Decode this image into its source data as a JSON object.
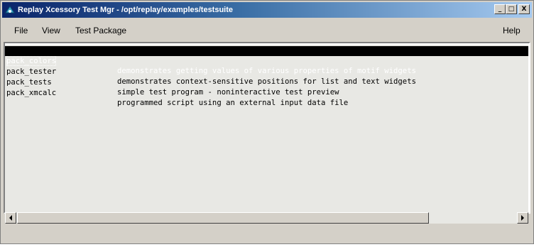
{
  "window": {
    "title": "Replay Xcessory Test Mgr - /opt/replay/examples/testsuite",
    "controls": {
      "minimize": "_",
      "maximize": "□",
      "close": "X"
    }
  },
  "menubar": {
    "items": [
      {
        "label": "File"
      },
      {
        "label": "View"
      },
      {
        "label": "Test Package"
      }
    ],
    "help": "Help"
  },
  "packages": [
    {
      "name": "pack_colors",
      "description": "demonstrates getting values of various properties of motif widgets",
      "selected": true
    },
    {
      "name": "pack_tester",
      "description": "demonstrates context-sensitive positions for list and text widgets",
      "selected": false
    },
    {
      "name": "pack_tests",
      "description": "simple test program - noninteractive test preview",
      "selected": false
    },
    {
      "name": "pack_xmcalc",
      "description": "programmed script using an external input data file",
      "selected": false
    }
  ],
  "scrollbar": {
    "position": 0.0,
    "visible_fraction": 0.8
  },
  "icons": {
    "app": "replay-app-icon",
    "scroll_left": "arrow-left-icon",
    "scroll_right": "arrow-right-icon"
  }
}
